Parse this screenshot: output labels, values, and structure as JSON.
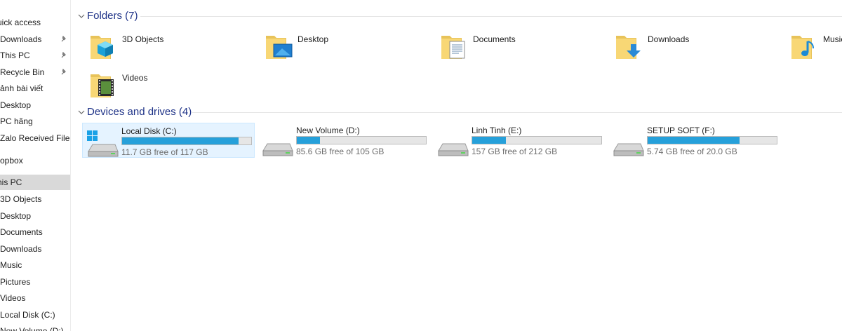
{
  "sidebar": {
    "items": [
      {
        "label": "uick access",
        "pinned": false,
        "selected": false
      },
      {
        "label": "Downloads",
        "pinned": true,
        "selected": false
      },
      {
        "label": "This PC",
        "pinned": true,
        "selected": false
      },
      {
        "label": "Recycle Bin",
        "pinned": true,
        "selected": false
      },
      {
        "label": "ảnh bài viết",
        "pinned": false,
        "selected": false
      },
      {
        "label": "Desktop",
        "pinned": false,
        "selected": false
      },
      {
        "label": "PC hãng",
        "pinned": false,
        "selected": false
      },
      {
        "label": "Zalo Received Files",
        "pinned": false,
        "selected": false
      },
      {
        "label": "ropbox",
        "pinned": false,
        "selected": false
      },
      {
        "label": "his PC",
        "pinned": false,
        "selected": true
      },
      {
        "label": "3D Objects",
        "pinned": false,
        "selected": false
      },
      {
        "label": "Desktop",
        "pinned": false,
        "selected": false
      },
      {
        "label": "Documents",
        "pinned": false,
        "selected": false
      },
      {
        "label": "Downloads",
        "pinned": false,
        "selected": false
      },
      {
        "label": "Music",
        "pinned": false,
        "selected": false
      },
      {
        "label": "Pictures",
        "pinned": false,
        "selected": false
      },
      {
        "label": "Videos",
        "pinned": false,
        "selected": false
      },
      {
        "label": "Local Disk (C:)",
        "pinned": false,
        "selected": false
      },
      {
        "label": "New Volume (D:)",
        "pinned": false,
        "selected": false
      }
    ]
  },
  "folders": {
    "title": "Folders (7)",
    "items": [
      {
        "label": "3D Objects",
        "icon": "3d-objects-icon"
      },
      {
        "label": "Desktop",
        "icon": "desktop-folder-icon"
      },
      {
        "label": "Documents",
        "icon": "documents-folder-icon"
      },
      {
        "label": "Downloads",
        "icon": "downloads-folder-icon"
      },
      {
        "label": "Music",
        "icon": "music-folder-icon"
      },
      {
        "label": "Videos",
        "icon": "videos-folder-icon"
      }
    ]
  },
  "drives": {
    "title": "Devices and drives (4)",
    "items": [
      {
        "label": "Local Disk (C:)",
        "free": "11.7 GB free of 117 GB",
        "used_fraction": 0.9,
        "icon": "windows-drive-icon",
        "selected": true
      },
      {
        "label": "New Volume (D:)",
        "free": "85.6 GB free of 105 GB",
        "used_fraction": 0.18,
        "icon": "hard-drive-icon",
        "selected": false
      },
      {
        "label": "Linh Tinh (E:)",
        "free": "157 GB free of 212 GB",
        "used_fraction": 0.26,
        "icon": "hard-drive-icon",
        "selected": false
      },
      {
        "label": "SETUP SOFT (F:)",
        "free": "5.74 GB free of 20.0 GB",
        "used_fraction": 0.71,
        "icon": "hard-drive-icon",
        "selected": false
      }
    ]
  },
  "colors": {
    "header_text": "#1e3287",
    "bar_fill": "#26a0da",
    "bar_track": "#e6e6e6",
    "selected_tile": "#e5f3ff",
    "selected_nav": "#d9d9d9",
    "folder_yellow": "#f8d775"
  }
}
